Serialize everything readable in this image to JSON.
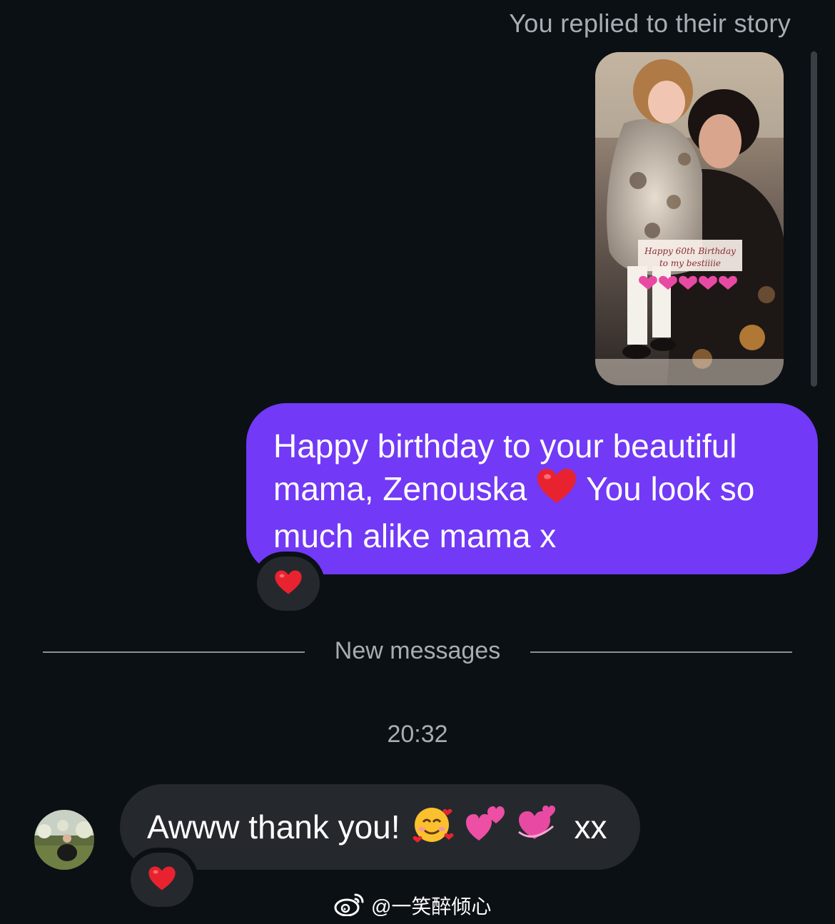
{
  "story": {
    "caption": "You replied to their story",
    "overlay_text_line1": "Happy 60th Birthday",
    "overlay_text_line2": "to my bestiiiie"
  },
  "outgoing": {
    "text_part1": "Happy birthday to your beautiful mama, Zenouska ",
    "text_part2": " You look so much alike mama x",
    "emoji": "red-heart"
  },
  "divider": {
    "label": "New messages"
  },
  "timestamp": "20:32",
  "incoming": {
    "text": "Awww thank you!",
    "emojis": [
      "smiling-face-with-hearts",
      "two-hearts",
      "revolving-hearts"
    ],
    "suffix": "xx"
  },
  "reactions": [
    "red-heart",
    "red-heart"
  ],
  "watermark": {
    "text": "@一笑醉倾心",
    "icon": "weibo-icon"
  },
  "colors": {
    "background": "#0b1014",
    "outgoing_bubble": "#7239f6",
    "incoming_bubble": "#25292e",
    "muted_text": "#a8adb4",
    "heart": "#e8232f"
  }
}
